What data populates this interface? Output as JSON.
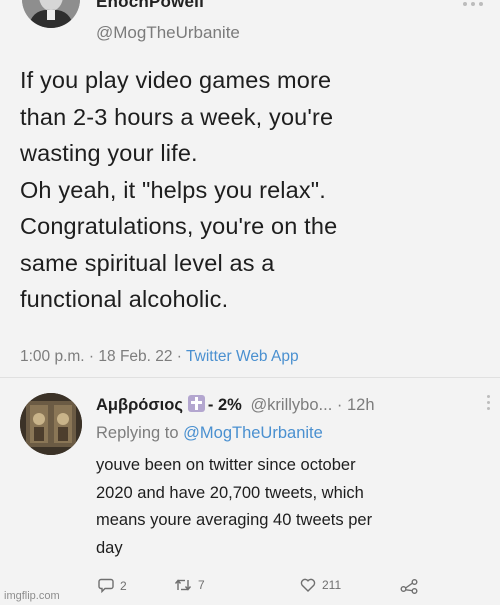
{
  "tweet": {
    "display_name": "EnochPowell",
    "handle": "@MogTheUrbanite",
    "lines": [
      "If you play video games more",
      "than 2-3 hours a week, you're",
      "wasting your life.",
      "Oh yeah, it \"helps you relax\".",
      "Congratulations, you're on the",
      "same spiritual level as a",
      "functional alcoholic."
    ],
    "timestamp": "1:00 p.m. · 18 Feb. 22 ·",
    "source": "Twitter Web App"
  },
  "reply": {
    "display_name": "Αμβρόσιος",
    "percent": "- 2%",
    "handle": "@krillybo...",
    "time": "· 12h",
    "replying_prefix": "Replying to",
    "replying_mention": "@MogTheUrbanite",
    "lines": [
      "youve been on twitter since october",
      "2020 and have 20,700 tweets, which",
      "means youre averaging 40 tweets per",
      "day"
    ],
    "reply_count": "2",
    "retweet_count": "7",
    "like_count": "211"
  },
  "icons": {
    "reply": "reply-icon",
    "retweet": "retweet-icon",
    "like": "like-icon",
    "share": "share-icon",
    "badge": "orthodox-cross-icon"
  },
  "colors": {
    "link": "#4a90d0",
    "muted": "#7d7d7d",
    "badge": "#b3a6cf"
  },
  "watermark": "imgflip.com"
}
